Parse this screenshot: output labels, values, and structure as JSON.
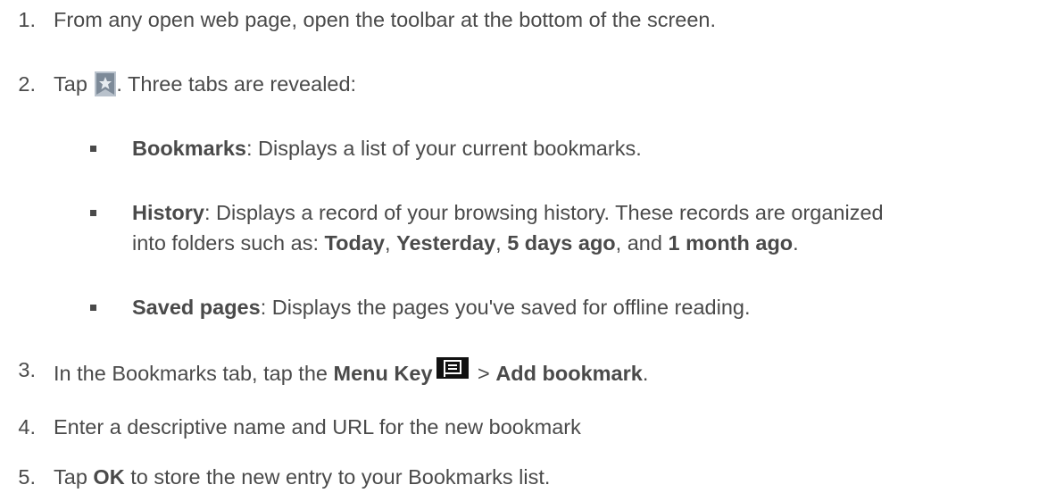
{
  "steps": [
    {
      "num": "1.",
      "text": "From any open web page, open the toolbar at the bottom of the screen."
    },
    {
      "num": "2.",
      "pre": "Tap ",
      "icon": "bookmark-star-icon",
      "post": ". Three tabs are revealed:"
    },
    {
      "num": "3.",
      "pre": "In the Bookmarks tab, tap the ",
      "bold1": "Menu Key",
      "icon": "menu-key-icon",
      "mid": " > ",
      "bold2": "Add bookmark",
      "post": "."
    },
    {
      "num": "4.",
      "text": "Enter a descriptive name and URL for the new bookmark"
    },
    {
      "num": "5.",
      "pre": "Tap ",
      "bold1": "OK",
      "post": " to store the new entry to your Bookmarks list."
    }
  ],
  "bullets": [
    {
      "term": "Bookmarks",
      "text": ": Displays a list of your current bookmarks."
    },
    {
      "term": "History",
      "text": ": Displays a record of your browsing history. These records are organized",
      "cont_pre": "into folders such as: ",
      "f1": "Today",
      "s1": ", ",
      "f2": "Yesterday",
      "s2": ", ",
      "f3": "5 days ago",
      "s3": ", and ",
      "f4": "1 month ago",
      "s4": "."
    },
    {
      "term": "Saved pages",
      "text": ": Displays the pages you've saved for offline reading."
    }
  ]
}
